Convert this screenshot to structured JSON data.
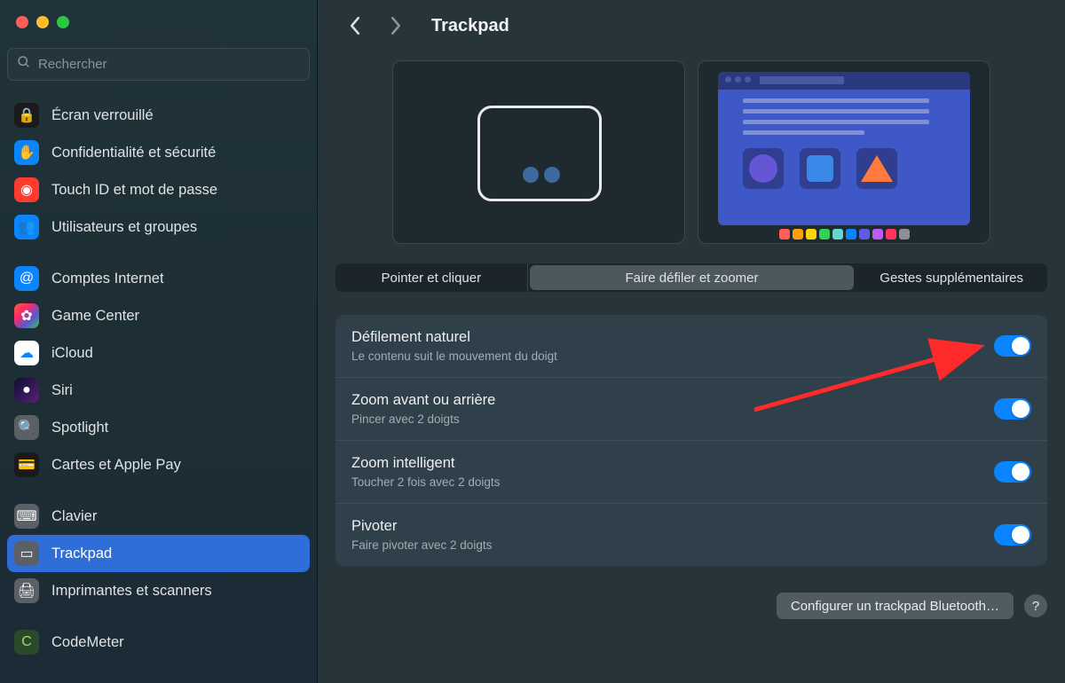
{
  "search": {
    "placeholder": "Rechercher"
  },
  "sidebar": {
    "groups": [
      [
        {
          "label": "Écran verrouillé",
          "iconClass": "ic-lock",
          "glyph": "🔒"
        },
        {
          "label": "Confidentialité et sécurité",
          "iconClass": "ic-hand",
          "glyph": "✋"
        },
        {
          "label": "Touch ID et mot de passe",
          "iconClass": "ic-touch",
          "glyph": "◉"
        },
        {
          "label": "Utilisateurs et groupes",
          "iconClass": "ic-users",
          "glyph": "👥"
        }
      ],
      [
        {
          "label": "Comptes Internet",
          "iconClass": "ic-internet",
          "glyph": "@"
        },
        {
          "label": "Game Center",
          "iconClass": "ic-gamecenter",
          "glyph": "✿"
        },
        {
          "label": "iCloud",
          "iconClass": "ic-icloud",
          "glyph": "☁"
        },
        {
          "label": "Siri",
          "iconClass": "ic-siri",
          "glyph": "●"
        },
        {
          "label": "Spotlight",
          "iconClass": "ic-spotlight",
          "glyph": "🔍"
        },
        {
          "label": "Cartes et Apple Pay",
          "iconClass": "ic-wallet",
          "glyph": "💳"
        }
      ],
      [
        {
          "label": "Clavier",
          "iconClass": "ic-keyboard",
          "glyph": "⌨"
        },
        {
          "label": "Trackpad",
          "iconClass": "ic-trackpad",
          "glyph": "▭",
          "selected": true
        },
        {
          "label": "Imprimantes et scanners",
          "iconClass": "ic-printer",
          "glyph": "🖨"
        }
      ],
      [
        {
          "label": "CodeMeter",
          "iconClass": "ic-codemeter",
          "glyph": "C"
        }
      ]
    ]
  },
  "header": {
    "title": "Trackpad"
  },
  "tabs": [
    {
      "label": "Pointer et cliquer",
      "active": false
    },
    {
      "label": "Faire défiler et zoomer",
      "active": true
    },
    {
      "label": "Gestes supplémentaires",
      "active": false
    }
  ],
  "settings": [
    {
      "title": "Défilement naturel",
      "sub": "Le contenu suit le mouvement du doigt",
      "on": true
    },
    {
      "title": "Zoom avant ou arrière",
      "sub": "Pincer avec 2 doigts",
      "on": true
    },
    {
      "title": "Zoom intelligent",
      "sub": "Toucher 2 fois avec 2 doigts",
      "on": true
    },
    {
      "title": "Pivoter",
      "sub": "Faire pivoter avec 2 doigts",
      "on": true
    }
  ],
  "footer": {
    "configure": "Configurer un trackpad Bluetooth…",
    "help": "?"
  },
  "dockColors": [
    "#ff5f57",
    "#ff9f0a",
    "#ffd60a",
    "#30d158",
    "#66d4cf",
    "#0a84ff",
    "#5e5ce6",
    "#bf5af2",
    "#ff375f",
    "#8e8e93"
  ]
}
